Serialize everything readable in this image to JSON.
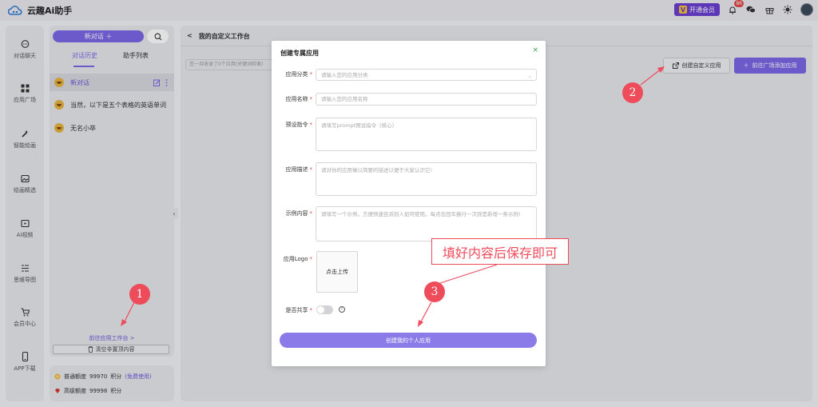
{
  "app": {
    "title": "云趣Ai助手"
  },
  "topbar": {
    "vip_label": "开通会员",
    "vip_badge": "V",
    "notification_count": "86"
  },
  "nav": {
    "items": [
      {
        "label": "对话聊天",
        "icon": "chat-icon"
      },
      {
        "label": "应用广场",
        "icon": "grid-icon"
      },
      {
        "label": "智能绘画",
        "icon": "magic-wand-icon"
      },
      {
        "label": "绘画精选",
        "icon": "gallery-icon"
      },
      {
        "label": "AI视频",
        "icon": "video-icon"
      },
      {
        "label": "思维导图",
        "icon": "mindmap-icon"
      },
      {
        "label": "会员中心",
        "icon": "cart-icon"
      },
      {
        "label": "APP下载",
        "icon": "phone-icon"
      }
    ]
  },
  "sidebar": {
    "new_chat_label": "新对话 ＋",
    "tabs": [
      "对话历史",
      "助手列表"
    ],
    "chats": [
      {
        "title": "新对话"
      },
      {
        "title": "当然，以下是五个表格的英语单词"
      },
      {
        "title": "无名小卒"
      }
    ],
    "goto_workbench": "前往应用工作台 >",
    "clear_label": "清空非置顶内容"
  },
  "quota": {
    "normal_label": "普通额度",
    "normal_value": "99970",
    "normal_unit": "积分",
    "normal_free": "(免费使用)",
    "premium_label": "高级额度",
    "premium_value": "99998",
    "premium_unit": "积分"
  },
  "main": {
    "breadcrumb_back": "<",
    "breadcrumb_title": "我的自定义工作台",
    "filter_placeholder": "您一共收录了0个应用(关键词检索)",
    "btn_custom": "创建自定义应用",
    "btn_plaza": "前往广场添加应用"
  },
  "modal": {
    "title": "创建专属应用",
    "close": "×",
    "fields": {
      "category": {
        "label": "应用分类",
        "placeholder": "请输入您的应用分类"
      },
      "name": {
        "label": "应用名称",
        "placeholder": "请输入您的应用名称"
      },
      "prompt": {
        "label": "预设指令",
        "placeholder": "请填写prompt预设指令（核心）"
      },
      "desc": {
        "label": "应用描述",
        "placeholder": "请对你的应用做以简要的描述以便于大家认识它!"
      },
      "example": {
        "label": "示例内容",
        "placeholder": "请填写一个示例。方便快速告诉别人如何使用。每点击回车换行一次则是新增一条示例!"
      },
      "logo": {
        "label": "应用Logo",
        "upload": "点击上传"
      },
      "share": {
        "label": "是否共享"
      }
    },
    "submit": "创建我的个人应用"
  },
  "annotations": {
    "step1": "1",
    "step2": "2",
    "step3": "3",
    "callout": "填好内容后保存即可",
    "color": "#ee4b5b"
  }
}
